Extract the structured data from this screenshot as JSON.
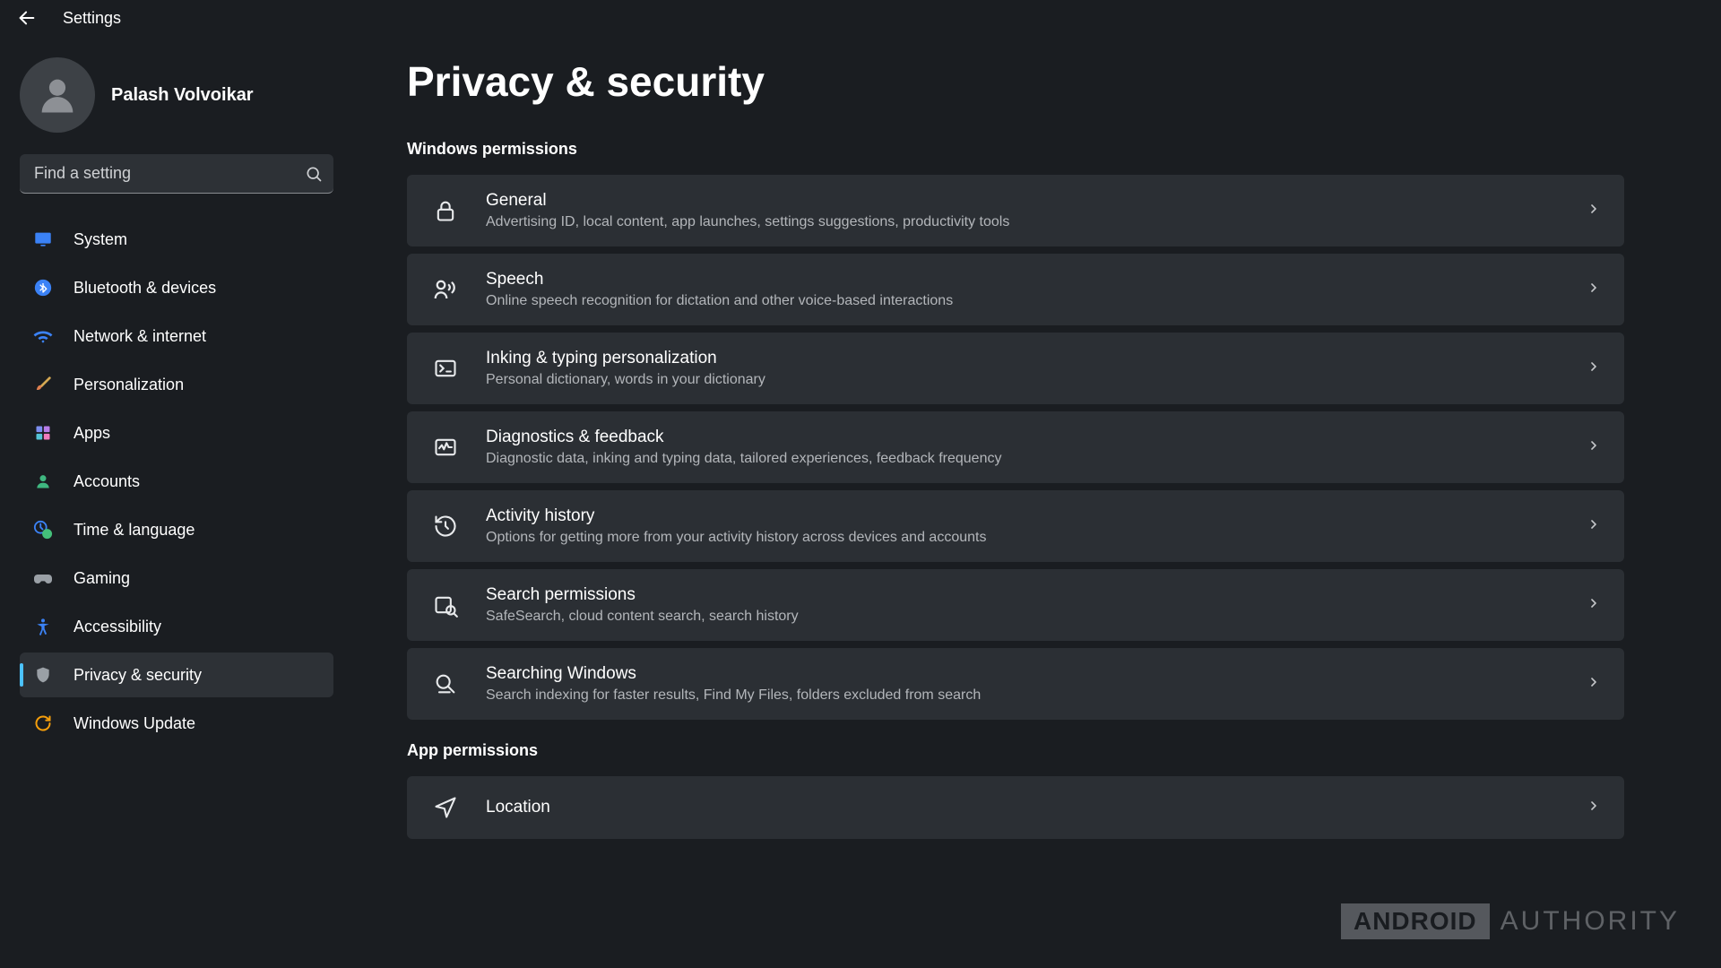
{
  "titlebar": {
    "app_name": "Settings"
  },
  "profile": {
    "name": "Palash Volvoikar"
  },
  "search": {
    "placeholder": "Find a setting"
  },
  "nav": {
    "items": [
      {
        "id": "system",
        "label": "System"
      },
      {
        "id": "bluetooth",
        "label": "Bluetooth & devices"
      },
      {
        "id": "network",
        "label": "Network & internet"
      },
      {
        "id": "personalization",
        "label": "Personalization"
      },
      {
        "id": "apps",
        "label": "Apps"
      },
      {
        "id": "accounts",
        "label": "Accounts"
      },
      {
        "id": "time",
        "label": "Time & language"
      },
      {
        "id": "gaming",
        "label": "Gaming"
      },
      {
        "id": "accessibility",
        "label": "Accessibility"
      },
      {
        "id": "privacy",
        "label": "Privacy & security"
      },
      {
        "id": "update",
        "label": "Windows Update"
      }
    ]
  },
  "page": {
    "title": "Privacy & security",
    "sections": {
      "windows_permissions_header": "Windows permissions",
      "app_permissions_header": "App permissions"
    },
    "cards": {
      "general": {
        "title": "General",
        "sub": "Advertising ID, local content, app launches, settings suggestions, productivity tools"
      },
      "speech": {
        "title": "Speech",
        "sub": "Online speech recognition for dictation and other voice-based interactions"
      },
      "inking": {
        "title": "Inking & typing personalization",
        "sub": "Personal dictionary, words in your dictionary"
      },
      "diagnostics": {
        "title": "Diagnostics & feedback",
        "sub": "Diagnostic data, inking and typing data, tailored experiences, feedback frequency"
      },
      "activity": {
        "title": "Activity history",
        "sub": "Options for getting more from your activity history across devices and accounts"
      },
      "searchperm": {
        "title": "Search permissions",
        "sub": "SafeSearch, cloud content search, search history"
      },
      "searching": {
        "title": "Searching Windows",
        "sub": "Search indexing for faster results, Find My Files, folders excluded from search"
      },
      "location": {
        "title": "Location"
      }
    }
  },
  "watermark": {
    "badge": "ANDROID",
    "text": "AUTHORITY"
  }
}
